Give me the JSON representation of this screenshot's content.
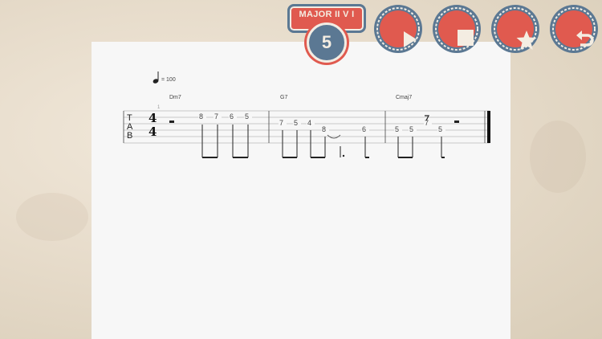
{
  "level": {
    "title": "MAJOR II V I",
    "number": "5"
  },
  "controls": [
    {
      "name": "play-button",
      "icon": "play-icon"
    },
    {
      "name": "stop-button",
      "icon": "stop-icon"
    },
    {
      "name": "favorite-button",
      "icon": "star-icon"
    },
    {
      "name": "back-button",
      "icon": "undo-icon"
    }
  ],
  "colors": {
    "accent_red": "#e05a4f",
    "accent_blue": "#5b7893",
    "cream": "#f2ede4"
  },
  "score": {
    "tempo": "= 100",
    "measure_number": "1",
    "chords": [
      "Dm7",
      "G7",
      "Cmaj7"
    ],
    "tab_clef": [
      "T",
      "A",
      "B"
    ],
    "time_signature": {
      "top": "4",
      "bottom": "4"
    },
    "measure1_notes": [
      "8",
      "7",
      "6",
      "5"
    ],
    "measure2_notes": [
      "7",
      "5",
      "4",
      "8",
      "6"
    ],
    "measure3_notes": [
      "5",
      "5",
      "7",
      "5"
    ]
  }
}
